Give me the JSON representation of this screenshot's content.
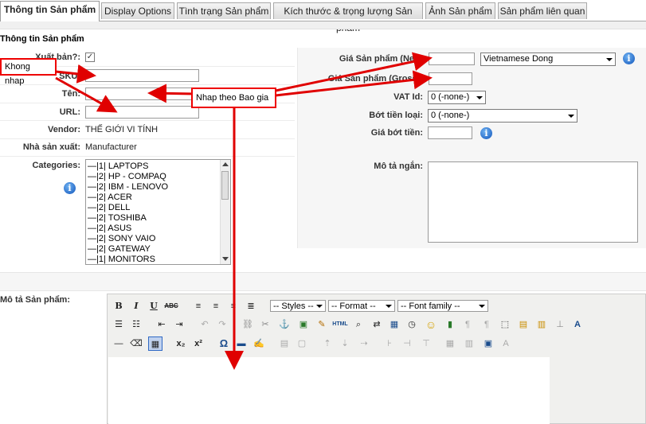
{
  "tabs": [
    {
      "label": "Thông tin Sản phẩm"
    },
    {
      "label": "Display Options"
    },
    {
      "label": "Tình trạng Sản phẩm"
    },
    {
      "label": "Kích thước & trọng lượng Sản phẩm"
    },
    {
      "label": "Ảnh Sản phẩm"
    },
    {
      "label": "Sản phẩm liên quan"
    }
  ],
  "section_title": "Thông tin Sản phẩm",
  "left": {
    "published_label": "Xuất bản?:",
    "published_checked": true,
    "sku_label": "SKU:",
    "name_label": "Tên:",
    "url_label": "URL:",
    "vendor_label": "Vendor:",
    "vendor_value": "THẾ GIỚI VI TÍNH",
    "manufacturer_label": "Nhà sản xuất:",
    "manufacturer_value": "Manufacturer",
    "categories_label": "Categories:",
    "categories": [
      "—|1| LAPTOPS",
      "—|2| HP - COMPAQ",
      "—|2| IBM - LENOVO",
      "—|2| ACER",
      "—|2| DELL",
      "—|2| TOSHIBA",
      "—|2| ASUS",
      "—|2| SONY VAIO",
      "—|2| GATEWAY",
      "—|1| MONITORS"
    ]
  },
  "right": {
    "price_net_label": "Giá Sản phẩm (Net):",
    "currency_value": "Vietnamese Dong",
    "price_gross_label": "Giá Sản phẩm (Gross):",
    "vat_label": "VAT Id:",
    "vat_value": "0 (-none-)",
    "discount_type_label": "Bớt tiền loại:",
    "discount_type_value": "0 (-none-)",
    "discount_price_label": "Giá bớt tiền:",
    "short_desc_label": "Mô tả ngắn:"
  },
  "description_label": "Mô tả Sản phẩm:",
  "editor": {
    "styles_label": "-- Styles --",
    "format_label": "-- Format --",
    "font_family_label": "-- Font family --",
    "toolbar_row1": [
      "B",
      "I",
      "U",
      "ABC"
    ],
    "html_label": "HTML",
    "subscript_label": "x₂",
    "superscript_label": "x²",
    "omega_label": "Ω"
  },
  "annotations": {
    "khong_nhap": "Khong nhap",
    "nhap_theo_bao_gia": "Nhap theo Bao gia"
  },
  "colors": {
    "annotation": "#e00000",
    "info_icon": "#1155bb"
  }
}
